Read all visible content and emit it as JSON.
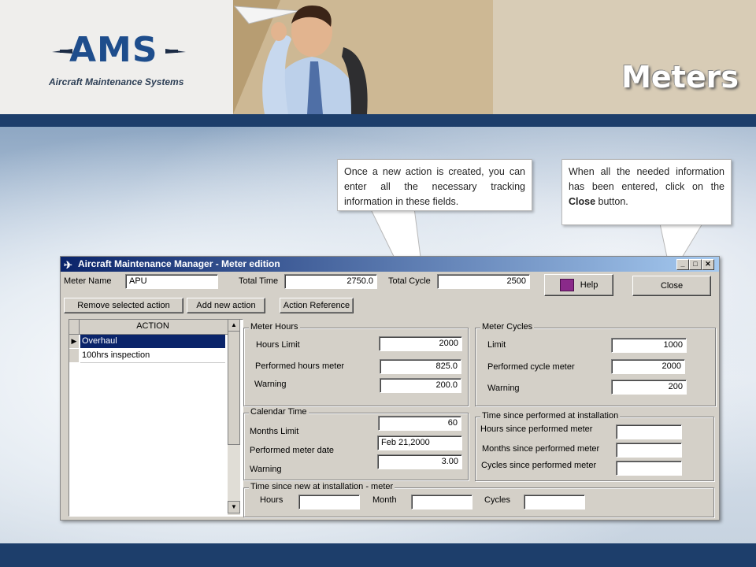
{
  "header": {
    "logo_text": "AMS",
    "logo_sub": "Aircraft Maintenance Systems",
    "title": "Meters"
  },
  "callouts": {
    "left": "Once a new action is created, you can enter all the necessary tracking information in these fields.",
    "right_before": "When all the needed information has been entered, click on the ",
    "right_bold": "Close",
    "right_after": " button."
  },
  "window": {
    "title": "Aircraft Maintenance Manager - Meter edition",
    "meter_name_label": "Meter Name",
    "meter_name_value": "APU",
    "total_time_label": "Total Time",
    "total_time_value": "2750.0",
    "total_cycle_label": "Total Cycle",
    "total_cycle_value": "2500",
    "help_label": "Help",
    "close_label": "Close",
    "remove_label": "Remove selected action",
    "add_label": "Add new action",
    "ref_label": "Action Reference",
    "action_header": "ACTION",
    "actions": [
      "Overhaul",
      "100hrs inspection"
    ],
    "meter_hours": {
      "title": "Meter Hours",
      "limit_label": "Hours Limit",
      "limit_value": "2000",
      "performed_label": "Performed hours meter",
      "performed_value": "825.0",
      "warning_label": "Warning",
      "warning_value": "200.0"
    },
    "meter_cycles": {
      "title": "Meter Cycles",
      "limit_label": "Limit",
      "limit_value": "1000",
      "performed_label": "Performed cycle meter",
      "performed_value": "2000",
      "warning_label": "Warning",
      "warning_value": "200"
    },
    "calendar": {
      "title": "Calendar Time",
      "months_label": "Months Limit",
      "months_value": "60",
      "date_label": "Performed meter date",
      "date_value": "Feb 21,2000",
      "warning_label": "Warning",
      "warning_value": "3.00"
    },
    "since_performed": {
      "title": "Time since performed at installation",
      "hours_label": "Hours since performed meter",
      "months_label": "Months since performed meter",
      "cycles_label": "Cycles since performed meter"
    },
    "since_new": {
      "title": "Time since new at installation - meter",
      "hours_label": "Hours",
      "month_label": "Month",
      "cycles_label": "Cycles"
    }
  },
  "colors": {
    "header_bar": "#1d3e6b",
    "title_bar": "#0a246a",
    "logo": "#1e4d8c"
  }
}
